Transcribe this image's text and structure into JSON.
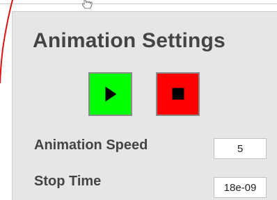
{
  "panel": {
    "title": "Animation Settings"
  },
  "controls": {
    "play_icon": "play-icon",
    "stop_icon": "stop-icon",
    "play_color": "#00ff00",
    "stop_color": "#ff0000"
  },
  "settings": {
    "speed_label": "Animation Speed",
    "speed_value": "5",
    "stop_time_label": "Stop Time",
    "stop_time_value": "18e-09"
  }
}
